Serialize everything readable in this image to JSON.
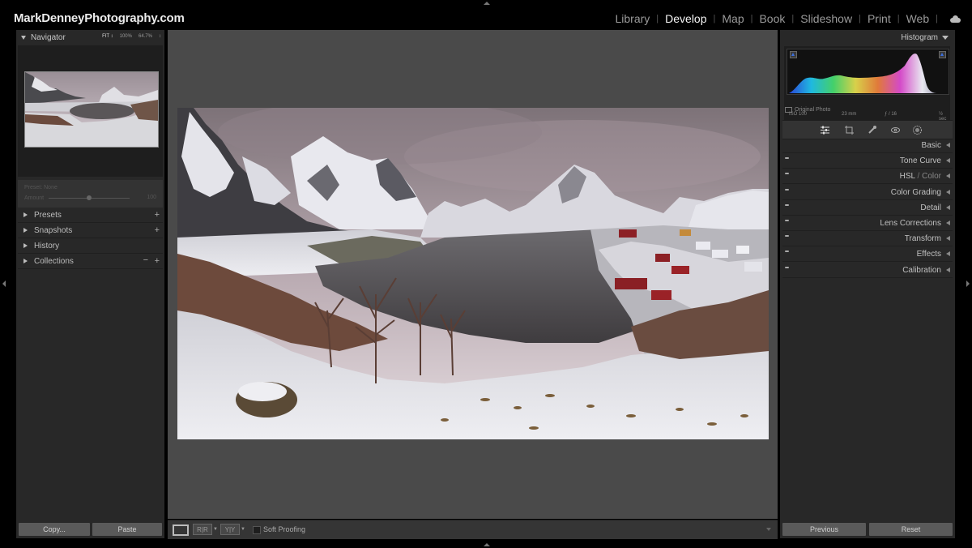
{
  "brand": "MarkDenneyPhotography.com",
  "modules": [
    {
      "label": "Library",
      "active": false
    },
    {
      "label": "Develop",
      "active": true
    },
    {
      "label": "Map",
      "active": false
    },
    {
      "label": "Book",
      "active": false
    },
    {
      "label": "Slideshow",
      "active": false
    },
    {
      "label": "Print",
      "active": false
    },
    {
      "label": "Web",
      "active": false
    }
  ],
  "navigator": {
    "title": "Navigator",
    "zoom_options": [
      "FIT ↕",
      "100%",
      "64.7%",
      "↕"
    ]
  },
  "preset_amount": {
    "label": "Preset: None",
    "amount_label": "Amount",
    "value": "100"
  },
  "left_sections": [
    {
      "label": "Presets",
      "plus": "+"
    },
    {
      "label": "Snapshots",
      "plus": "+"
    },
    {
      "label": "History",
      "clear": "x"
    },
    {
      "label": "Collections",
      "minus": "−",
      "plus": "+"
    }
  ],
  "left_buttons": {
    "copy": "Copy...",
    "paste": "Paste"
  },
  "toolbar": {
    "soft_proofing": "Soft Proofing"
  },
  "histogram": {
    "title": "Histogram",
    "iso": "ISO 100",
    "focal": "23 mm",
    "aperture": "ƒ / 16",
    "shutter": "½ sec",
    "original_photo": "Original Photo"
  },
  "right_sections": [
    {
      "label": "Basic"
    },
    {
      "label": "Tone Curve"
    },
    {
      "label": "HSL",
      "label2": "Color"
    },
    {
      "label": "Color Grading"
    },
    {
      "label": "Detail"
    },
    {
      "label": "Lens Corrections"
    },
    {
      "label": "Transform"
    },
    {
      "label": "Effects"
    },
    {
      "label": "Calibration"
    }
  ],
  "right_buttons": {
    "previous": "Previous",
    "reset": "Reset"
  },
  "colors": {
    "accent": "#3b6fe0",
    "panel": "#282828",
    "workspace": "#4a4a4a"
  }
}
